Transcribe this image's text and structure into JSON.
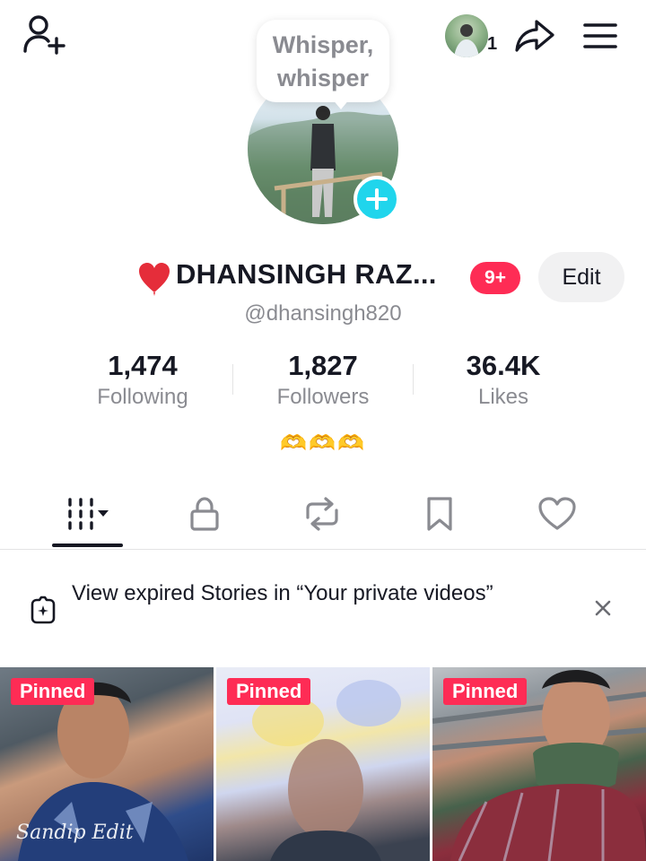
{
  "header": {
    "friend_count": "1"
  },
  "whisper_bubble": {
    "line1": "Whisper,",
    "line2": "whisper"
  },
  "profile": {
    "display_name": "DHANSINGH RAZ...",
    "name_emoji": "❤️",
    "notification_badge": "9+",
    "edit_label": "Edit",
    "username": "@dhansingh820",
    "bio": "🫶🫶🫶"
  },
  "stats": [
    {
      "value": "1,474",
      "label": "Following"
    },
    {
      "value": "1,827",
      "label": "Followers"
    },
    {
      "value": "36.4K",
      "label": "Likes"
    }
  ],
  "tabs": [
    {
      "icon": "grid-videos-icon",
      "active": true
    },
    {
      "icon": "lock-icon",
      "active": false
    },
    {
      "icon": "repost-icon",
      "active": false
    },
    {
      "icon": "bookmark-icon",
      "active": false
    },
    {
      "icon": "heart-icon",
      "active": false
    }
  ],
  "stories_banner": {
    "text": "View expired Stories in “Your private videos”"
  },
  "videos": [
    {
      "badge": "Pinned",
      "watermark": "Sandip Edit"
    },
    {
      "badge": "Pinned"
    },
    {
      "badge": "Pinned"
    }
  ],
  "colors": {
    "accent_pink": "#fe2c55",
    "story_add": "#20d5ec",
    "muted_text": "#8a8b91"
  }
}
